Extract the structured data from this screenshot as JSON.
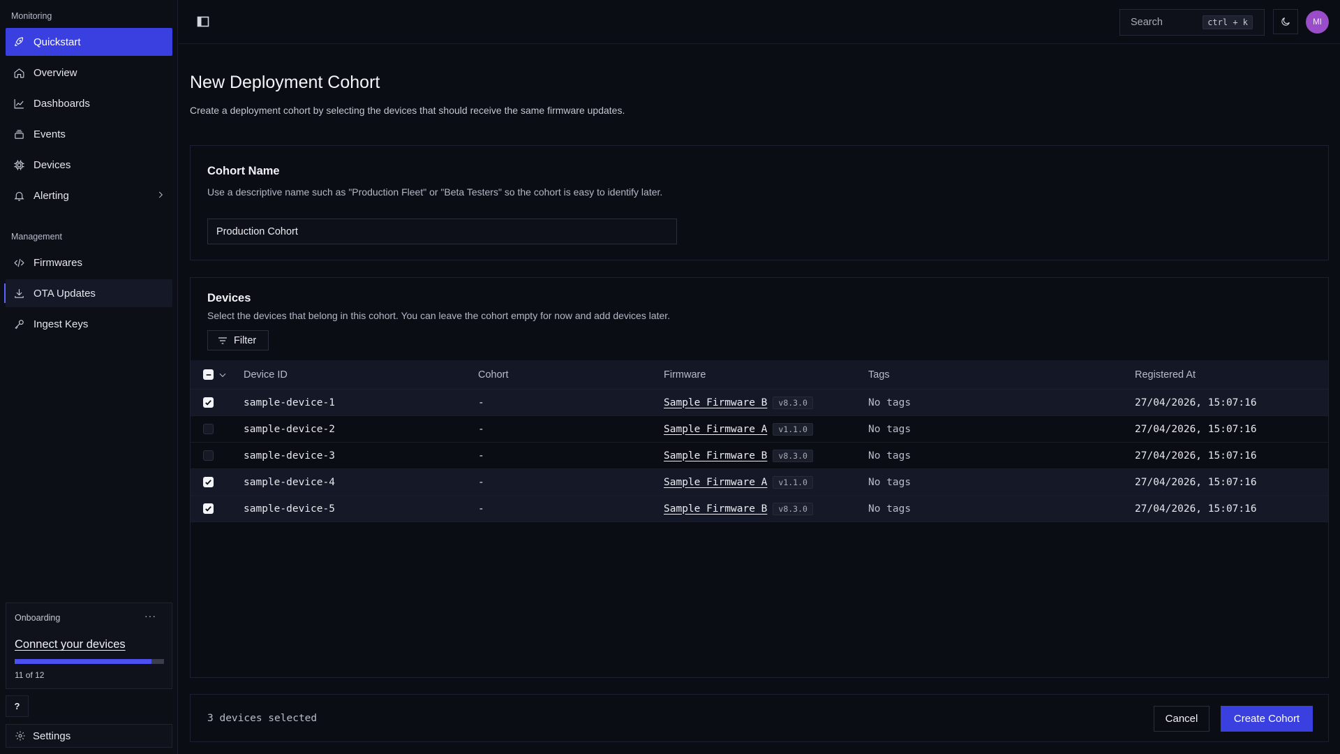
{
  "sidebar": {
    "monitoring_label": "Monitoring",
    "management_label": "Management",
    "items": [
      {
        "label": "Quickstart",
        "icon": "rocket-icon"
      },
      {
        "label": "Overview",
        "icon": "home-icon"
      },
      {
        "label": "Dashboards",
        "icon": "chart-icon"
      },
      {
        "label": "Events",
        "icon": "stack-icon"
      },
      {
        "label": "Devices",
        "icon": "chip-icon"
      },
      {
        "label": "Alerting",
        "icon": "bell-icon"
      },
      {
        "label": "Firmwares",
        "icon": "code-icon"
      },
      {
        "label": "OTA Updates",
        "icon": "download-icon"
      },
      {
        "label": "Ingest Keys",
        "icon": "key-icon"
      }
    ],
    "onboarding": {
      "title": "Onboarding",
      "link": "Connect your devices",
      "progress_text": "11 of 12",
      "progress_fraction": 0.9167
    },
    "help_label": "?",
    "settings_label": "Settings"
  },
  "topbar": {
    "search_placeholder": "Search",
    "search_shortcut": "ctrl + k",
    "avatar_initials": "MI"
  },
  "page": {
    "title": "New Deployment Cohort",
    "subtitle": "Create a deployment cohort by selecting the devices that should receive the same firmware updates."
  },
  "cohort_name": {
    "heading": "Cohort Name",
    "description": "Use a descriptive name such as \"Production Fleet\" or \"Beta Testers\" so the cohort is easy to identify later.",
    "value": "Production Cohort"
  },
  "devices": {
    "heading": "Devices",
    "description": "Select the devices that belong in this cohort. You can leave the cohort empty for now and add devices later.",
    "filter_label": "Filter",
    "columns": [
      "Device ID",
      "Cohort",
      "Firmware",
      "Tags",
      "Registered At"
    ],
    "rows": [
      {
        "id": "sample-device-1",
        "cohort": "-",
        "firmware": "Sample Firmware B",
        "version": "v8.3.0",
        "tags": "No tags",
        "registered": "27/04/2026, 15:07:16",
        "checked": true
      },
      {
        "id": "sample-device-2",
        "cohort": "-",
        "firmware": "Sample Firmware A",
        "version": "v1.1.0",
        "tags": "No tags",
        "registered": "27/04/2026, 15:07:16",
        "checked": false
      },
      {
        "id": "sample-device-3",
        "cohort": "-",
        "firmware": "Sample Firmware B",
        "version": "v8.3.0",
        "tags": "No tags",
        "registered": "27/04/2026, 15:07:16",
        "checked": false
      },
      {
        "id": "sample-device-4",
        "cohort": "-",
        "firmware": "Sample Firmware A",
        "version": "v1.1.0",
        "tags": "No tags",
        "registered": "27/04/2026, 15:07:16",
        "checked": true
      },
      {
        "id": "sample-device-5",
        "cohort": "-",
        "firmware": "Sample Firmware B",
        "version": "v8.3.0",
        "tags": "No tags",
        "registered": "27/04/2026, 15:07:16",
        "checked": true
      }
    ]
  },
  "footer": {
    "selected_text": "3 devices selected",
    "cancel_label": "Cancel",
    "create_label": "Create Cohort"
  },
  "colors": {
    "accent": "#3a3fe0",
    "background": "#0b0d14",
    "avatar": "#9a4dc9"
  }
}
